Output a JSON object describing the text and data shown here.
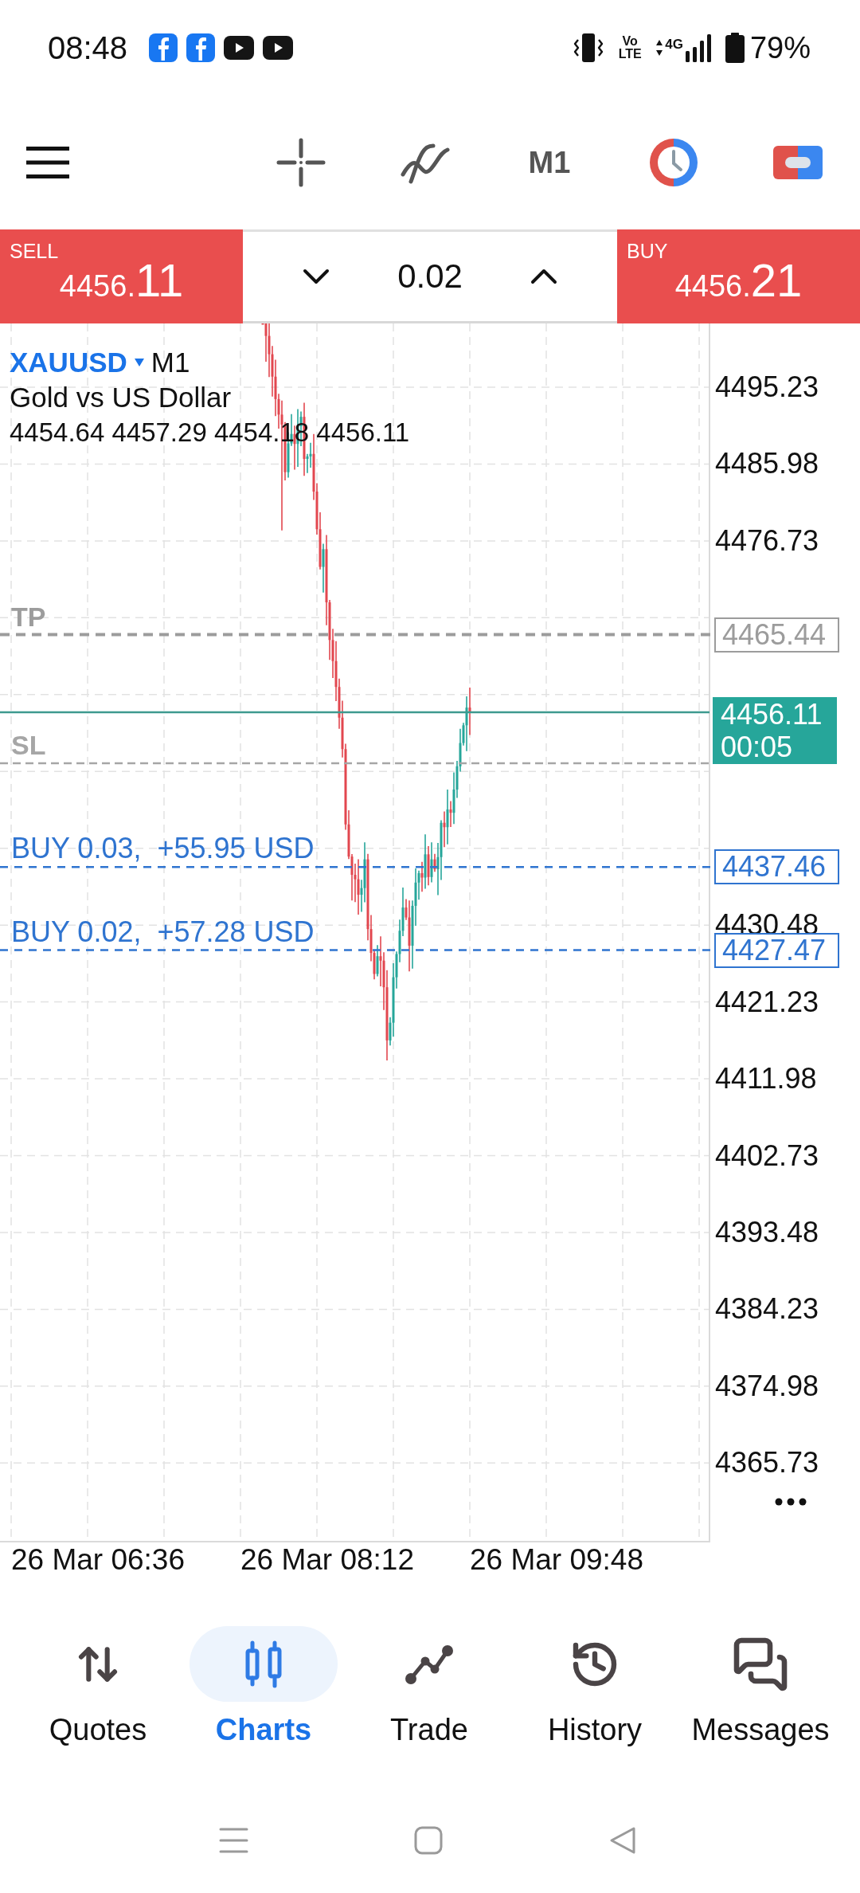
{
  "status_bar": {
    "time": "08:48",
    "volte": "Vo LTE",
    "network": "4G",
    "battery": "79%"
  },
  "toolbar": {
    "timeframe": "M1"
  },
  "trade_bar": {
    "sell": {
      "label": "SELL",
      "price": "4456.11"
    },
    "volume": "0.02",
    "buy": {
      "label": "BUY",
      "price": "4456.21"
    }
  },
  "chart": {
    "symbol": "XAUUSD",
    "timeframe": "M1",
    "description": "Gold vs US Dollar",
    "ohlc": "4454.64 4457.29 4454.18 4456.11",
    "price_axis": [
      "4495.23",
      "4485.98",
      "4476.73",
      "4430.48",
      "4421.23",
      "4411.98",
      "4402.73",
      "4393.48",
      "4384.23",
      "4374.98",
      "4365.73"
    ],
    "order_lines": [
      {
        "kind": "tp",
        "label": "TP",
        "price": "4465.44"
      },
      {
        "kind": "sl",
        "label": "SL"
      },
      {
        "kind": "buy",
        "label": "BUY 0.03,  +55.95 USD",
        "price": "4437.46"
      },
      {
        "kind": "buy",
        "label": "BUY 0.02,  +57.28 USD",
        "price": "4427.47"
      }
    ],
    "current_price": {
      "price": "4456.11",
      "countdown": "00:05"
    },
    "time_axis": [
      "26 Mar 06:36",
      "26 Mar 08:12",
      "26 Mar 09:48"
    ]
  },
  "bottom_nav": [
    {
      "label": "Quotes",
      "selected": false
    },
    {
      "label": "Charts",
      "selected": true
    },
    {
      "label": "Trade",
      "selected": false
    },
    {
      "label": "History",
      "selected": false
    },
    {
      "label": "Messages",
      "selected": false
    }
  ]
}
